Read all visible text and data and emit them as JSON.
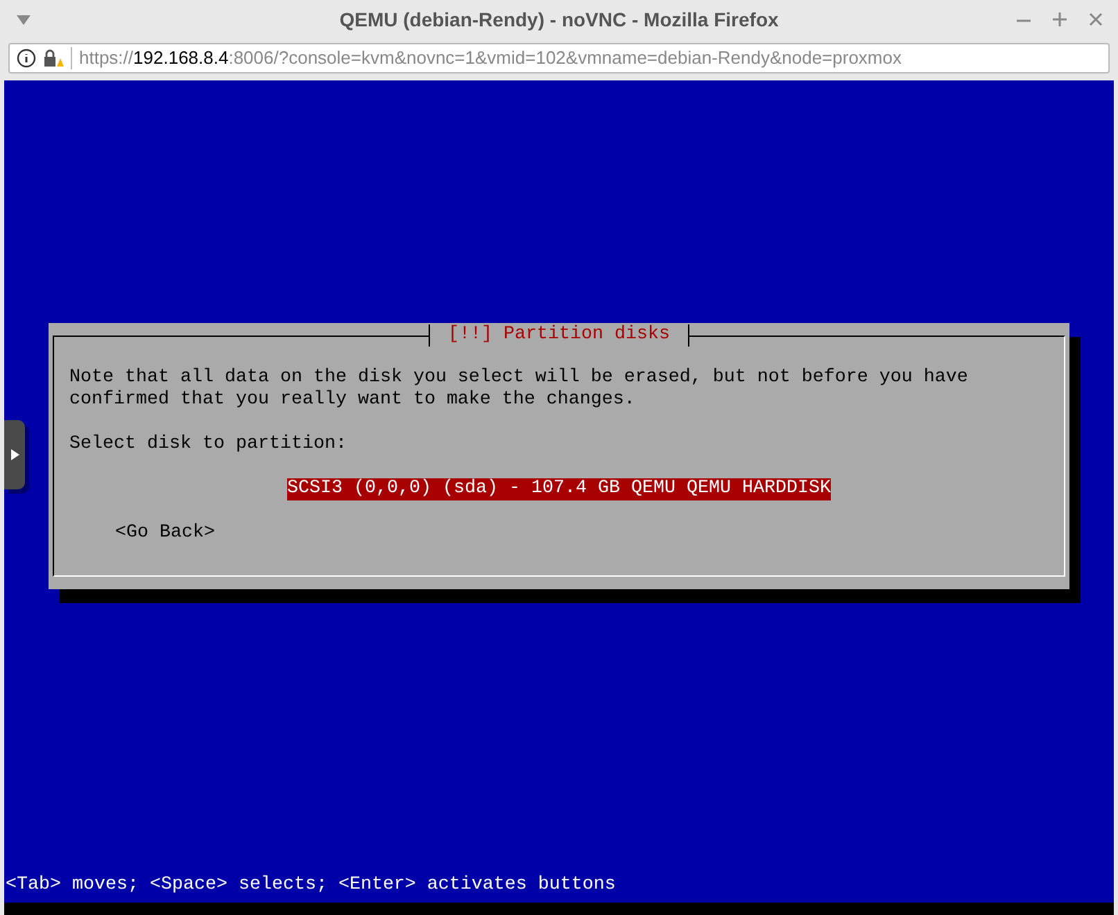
{
  "window": {
    "title": "QEMU (debian-Rendy) - noVNC - Mozilla Firefox"
  },
  "address_bar": {
    "scheme": "https://",
    "host": "192.168.8.4",
    "rest": ":8006/?console=kvm&novnc=1&vmid=102&vmname=debian-Rendy&node=proxmox"
  },
  "dialog": {
    "title": "[!!] Partition disks",
    "message": "Note that all data on the disk you select will be erased, but not before you have\nconfirmed that you really want to make the changes.",
    "prompt": "Select disk to partition:",
    "disks": [
      {
        "label": "SCSI3 (0,0,0) (sda) - 107.4 GB QEMU QEMU HARDDISK",
        "selected": true
      }
    ],
    "button": "<Go Back>"
  },
  "status_line": "<Tab> moves; <Space> selects; <Enter> activates buttons"
}
